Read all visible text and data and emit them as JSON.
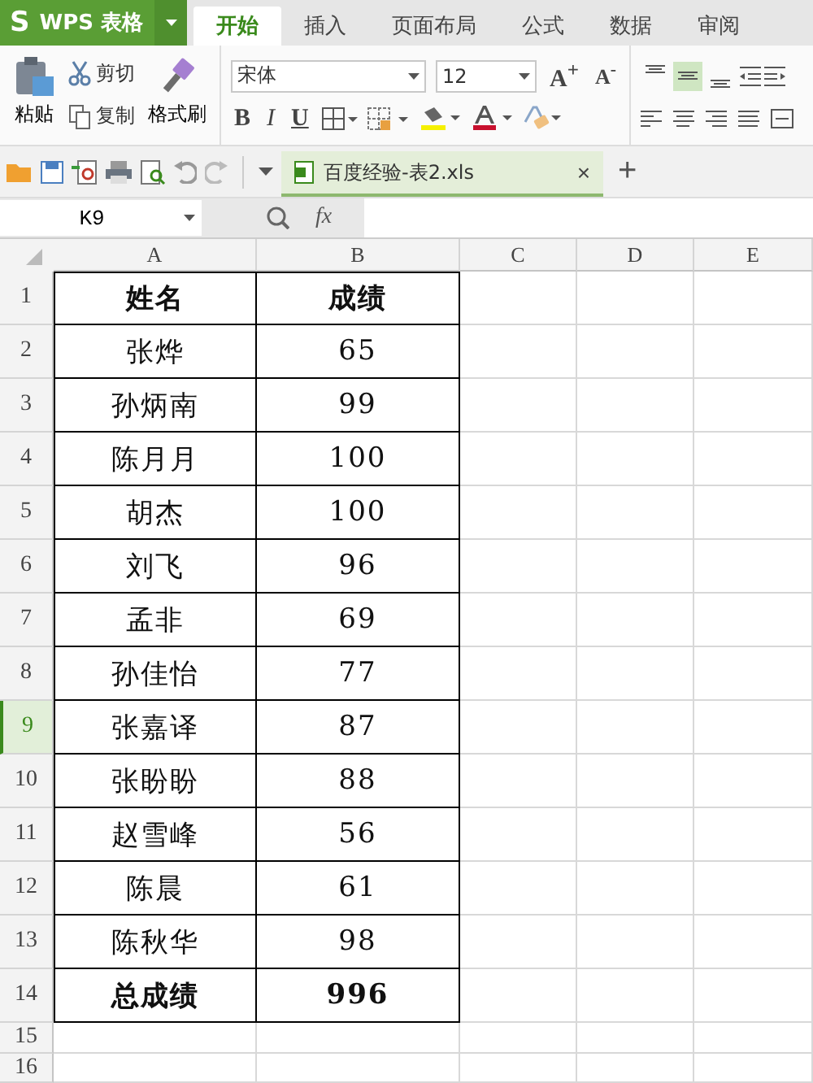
{
  "app": {
    "logo_mark": "S",
    "name": "WPS 表格"
  },
  "tabs": [
    {
      "label": "开始",
      "selected": true
    },
    {
      "label": "插入",
      "selected": false
    },
    {
      "label": "页面布局",
      "selected": false
    },
    {
      "label": "公式",
      "selected": false
    },
    {
      "label": "数据",
      "selected": false
    },
    {
      "label": "审阅",
      "selected": false
    }
  ],
  "clipboard": {
    "paste": "粘贴",
    "cut": "剪切",
    "copy": "复制",
    "format_painter": "格式刷"
  },
  "font": {
    "name": "宋体",
    "size": "12",
    "grow": "A$^{+}$",
    "shrink": "A$^{-}$",
    "bold": "B",
    "italic": "I",
    "underline": "U"
  },
  "align_buttons": [
    {
      "selected": false
    },
    {
      "selected": true
    },
    {
      "selected": false
    }
  ],
  "document_tab": {
    "title": "百度经验-表2.xls",
    "close": "×",
    "add": "+"
  },
  "formula_bar": {
    "name_box": "K9",
    "fx": "fx"
  },
  "columns": [
    "A",
    "B",
    "C",
    "D",
    "E"
  ],
  "rows": [
    {
      "number": "1",
      "cells": [
        "姓名",
        "成绩"
      ],
      "bold": true,
      "selected": false
    },
    {
      "number": "2",
      "cells": [
        "张烨",
        "65"
      ],
      "bold": false,
      "selected": false
    },
    {
      "number": "3",
      "cells": [
        "孙炳南",
        "99"
      ],
      "bold": false,
      "selected": false
    },
    {
      "number": "4",
      "cells": [
        "陈月月",
        "100"
      ],
      "bold": false,
      "selected": false
    },
    {
      "number": "5",
      "cells": [
        "胡杰",
        "100"
      ],
      "bold": false,
      "selected": false
    },
    {
      "number": "6",
      "cells": [
        "刘飞",
        "96"
      ],
      "bold": false,
      "selected": false
    },
    {
      "number": "7",
      "cells": [
        "孟非",
        "69"
      ],
      "bold": false,
      "selected": false
    },
    {
      "number": "8",
      "cells": [
        "孙佳怡",
        "77"
      ],
      "bold": false,
      "selected": false
    },
    {
      "number": "9",
      "cells": [
        "张嘉译",
        "87"
      ],
      "bold": false,
      "selected": true
    },
    {
      "number": "10",
      "cells": [
        "张盼盼",
        "88"
      ],
      "bold": false,
      "selected": false
    },
    {
      "number": "11",
      "cells": [
        "赵雪峰",
        "56"
      ],
      "bold": false,
      "selected": false
    },
    {
      "number": "12",
      "cells": [
        "陈晨",
        "61"
      ],
      "bold": false,
      "selected": false
    },
    {
      "number": "13",
      "cells": [
        "陈秋华",
        "98"
      ],
      "bold": false,
      "selected": false
    },
    {
      "number": "14",
      "cells": [
        "总成绩",
        "996"
      ],
      "bold": true,
      "selected": false
    },
    {
      "number": "15",
      "cells": [],
      "selected": false
    },
    {
      "number": "16",
      "cells": [],
      "selected": false
    }
  ]
}
